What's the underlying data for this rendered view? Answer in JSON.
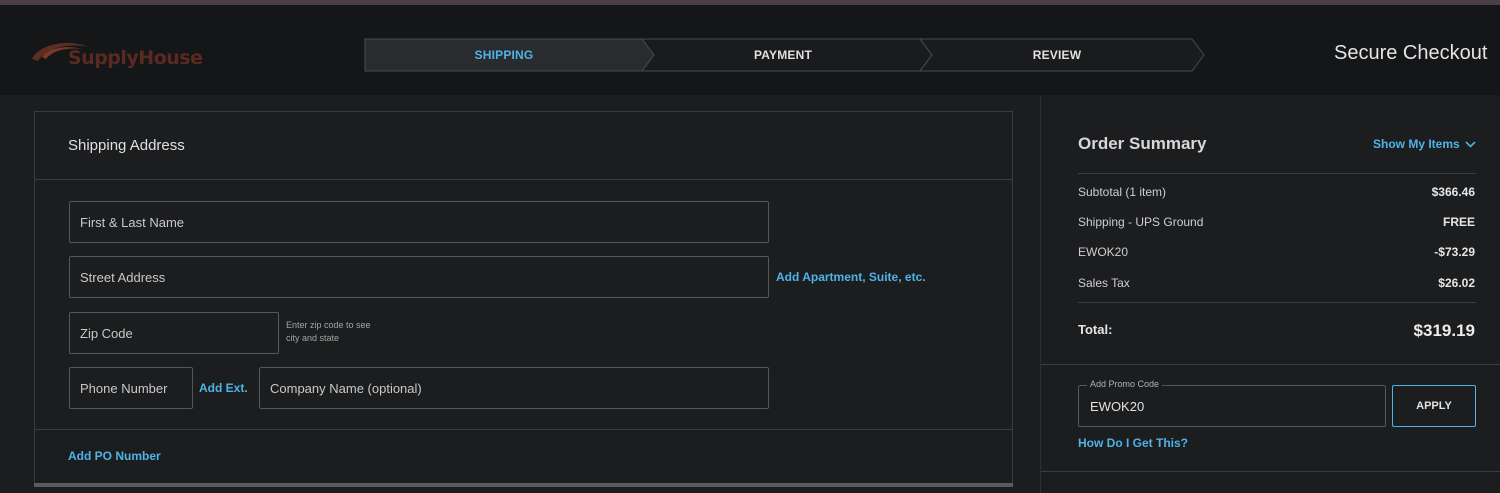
{
  "header": {
    "logo_text": "SupplyHouse",
    "secure_text": "Secure Checkout",
    "steps": [
      {
        "label": "SHIPPING",
        "active": true
      },
      {
        "label": "PAYMENT",
        "active": false
      },
      {
        "label": "REVIEW",
        "active": false
      }
    ]
  },
  "shipping": {
    "title": "Shipping Address",
    "name_placeholder": "First & Last Name",
    "street_placeholder": "Street Address",
    "add_apartment_link": "Add Apartment, Suite, etc.",
    "zip_placeholder": "Zip Code",
    "zip_hint_line1": "Enter zip code to see",
    "zip_hint_line2": "city and state",
    "phone_placeholder": "Phone Number",
    "add_ext_link": "Add Ext.",
    "company_placeholder": "Company Name (optional)",
    "add_po_link": "Add PO Number"
  },
  "summary": {
    "title": "Order Summary",
    "show_items": "Show My Items",
    "rows": [
      {
        "label": "Subtotal (1 item)",
        "value": "$366.46"
      },
      {
        "label": "Shipping - UPS Ground",
        "value": "FREE"
      },
      {
        "label": "EWOK20",
        "value": "-$73.29"
      },
      {
        "label": "Sales Tax",
        "value": "$26.02"
      }
    ],
    "total_label": "Total:",
    "total_value": "$319.19",
    "promo_label": "Add Promo Code",
    "promo_value": "EWOK20",
    "apply_label": "APPLY",
    "how_link": "How Do I Get This?"
  },
  "colors": {
    "accent": "#4fb3e8",
    "background": "#1c1d1f",
    "header_bg": "#151618"
  }
}
